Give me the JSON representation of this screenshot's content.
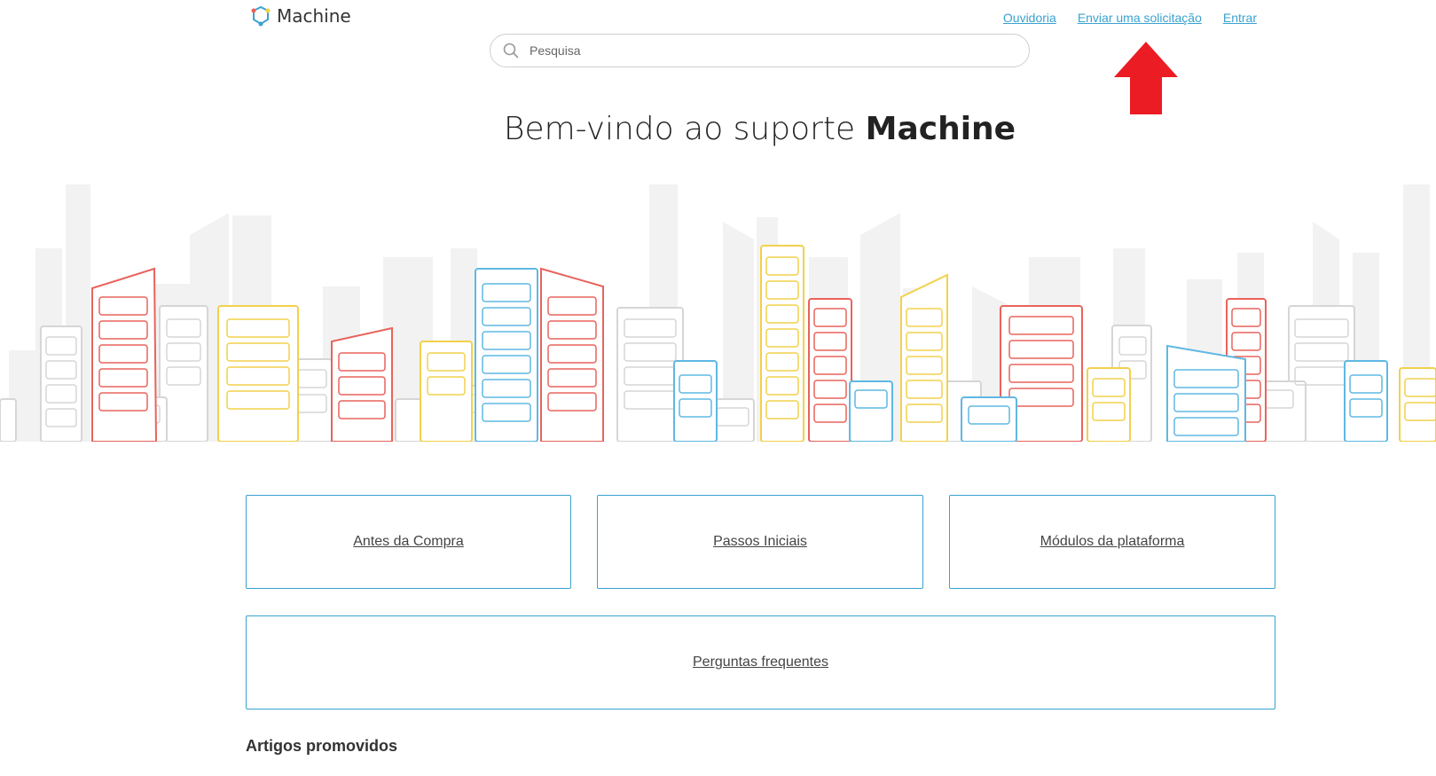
{
  "header": {
    "logo_text": "Machine",
    "nav": [
      {
        "label": "Ouvidoria"
      },
      {
        "label": "Enviar uma solicitação"
      },
      {
        "label": "Entrar"
      }
    ]
  },
  "search": {
    "placeholder": "Pesquisa",
    "icon": "search-icon"
  },
  "hero": {
    "title_prefix": "Bem-vindo ao suporte ",
    "title_brand": "Machine"
  },
  "categories": [
    {
      "label": "Antes da Compra"
    },
    {
      "label": "Passos Iniciais"
    },
    {
      "label": "Módulos da plataforma"
    },
    {
      "label": "Perguntas frequentes"
    }
  ],
  "promoted": {
    "heading": "Artigos promovidos"
  },
  "colors": {
    "link": "#3aa2cf",
    "arrow": "#ec1c24",
    "red_building": "#e8635c",
    "yellow_building": "#f2d14b",
    "blue_building": "#5fb8e3",
    "gray_building": "#d6d6d6"
  }
}
